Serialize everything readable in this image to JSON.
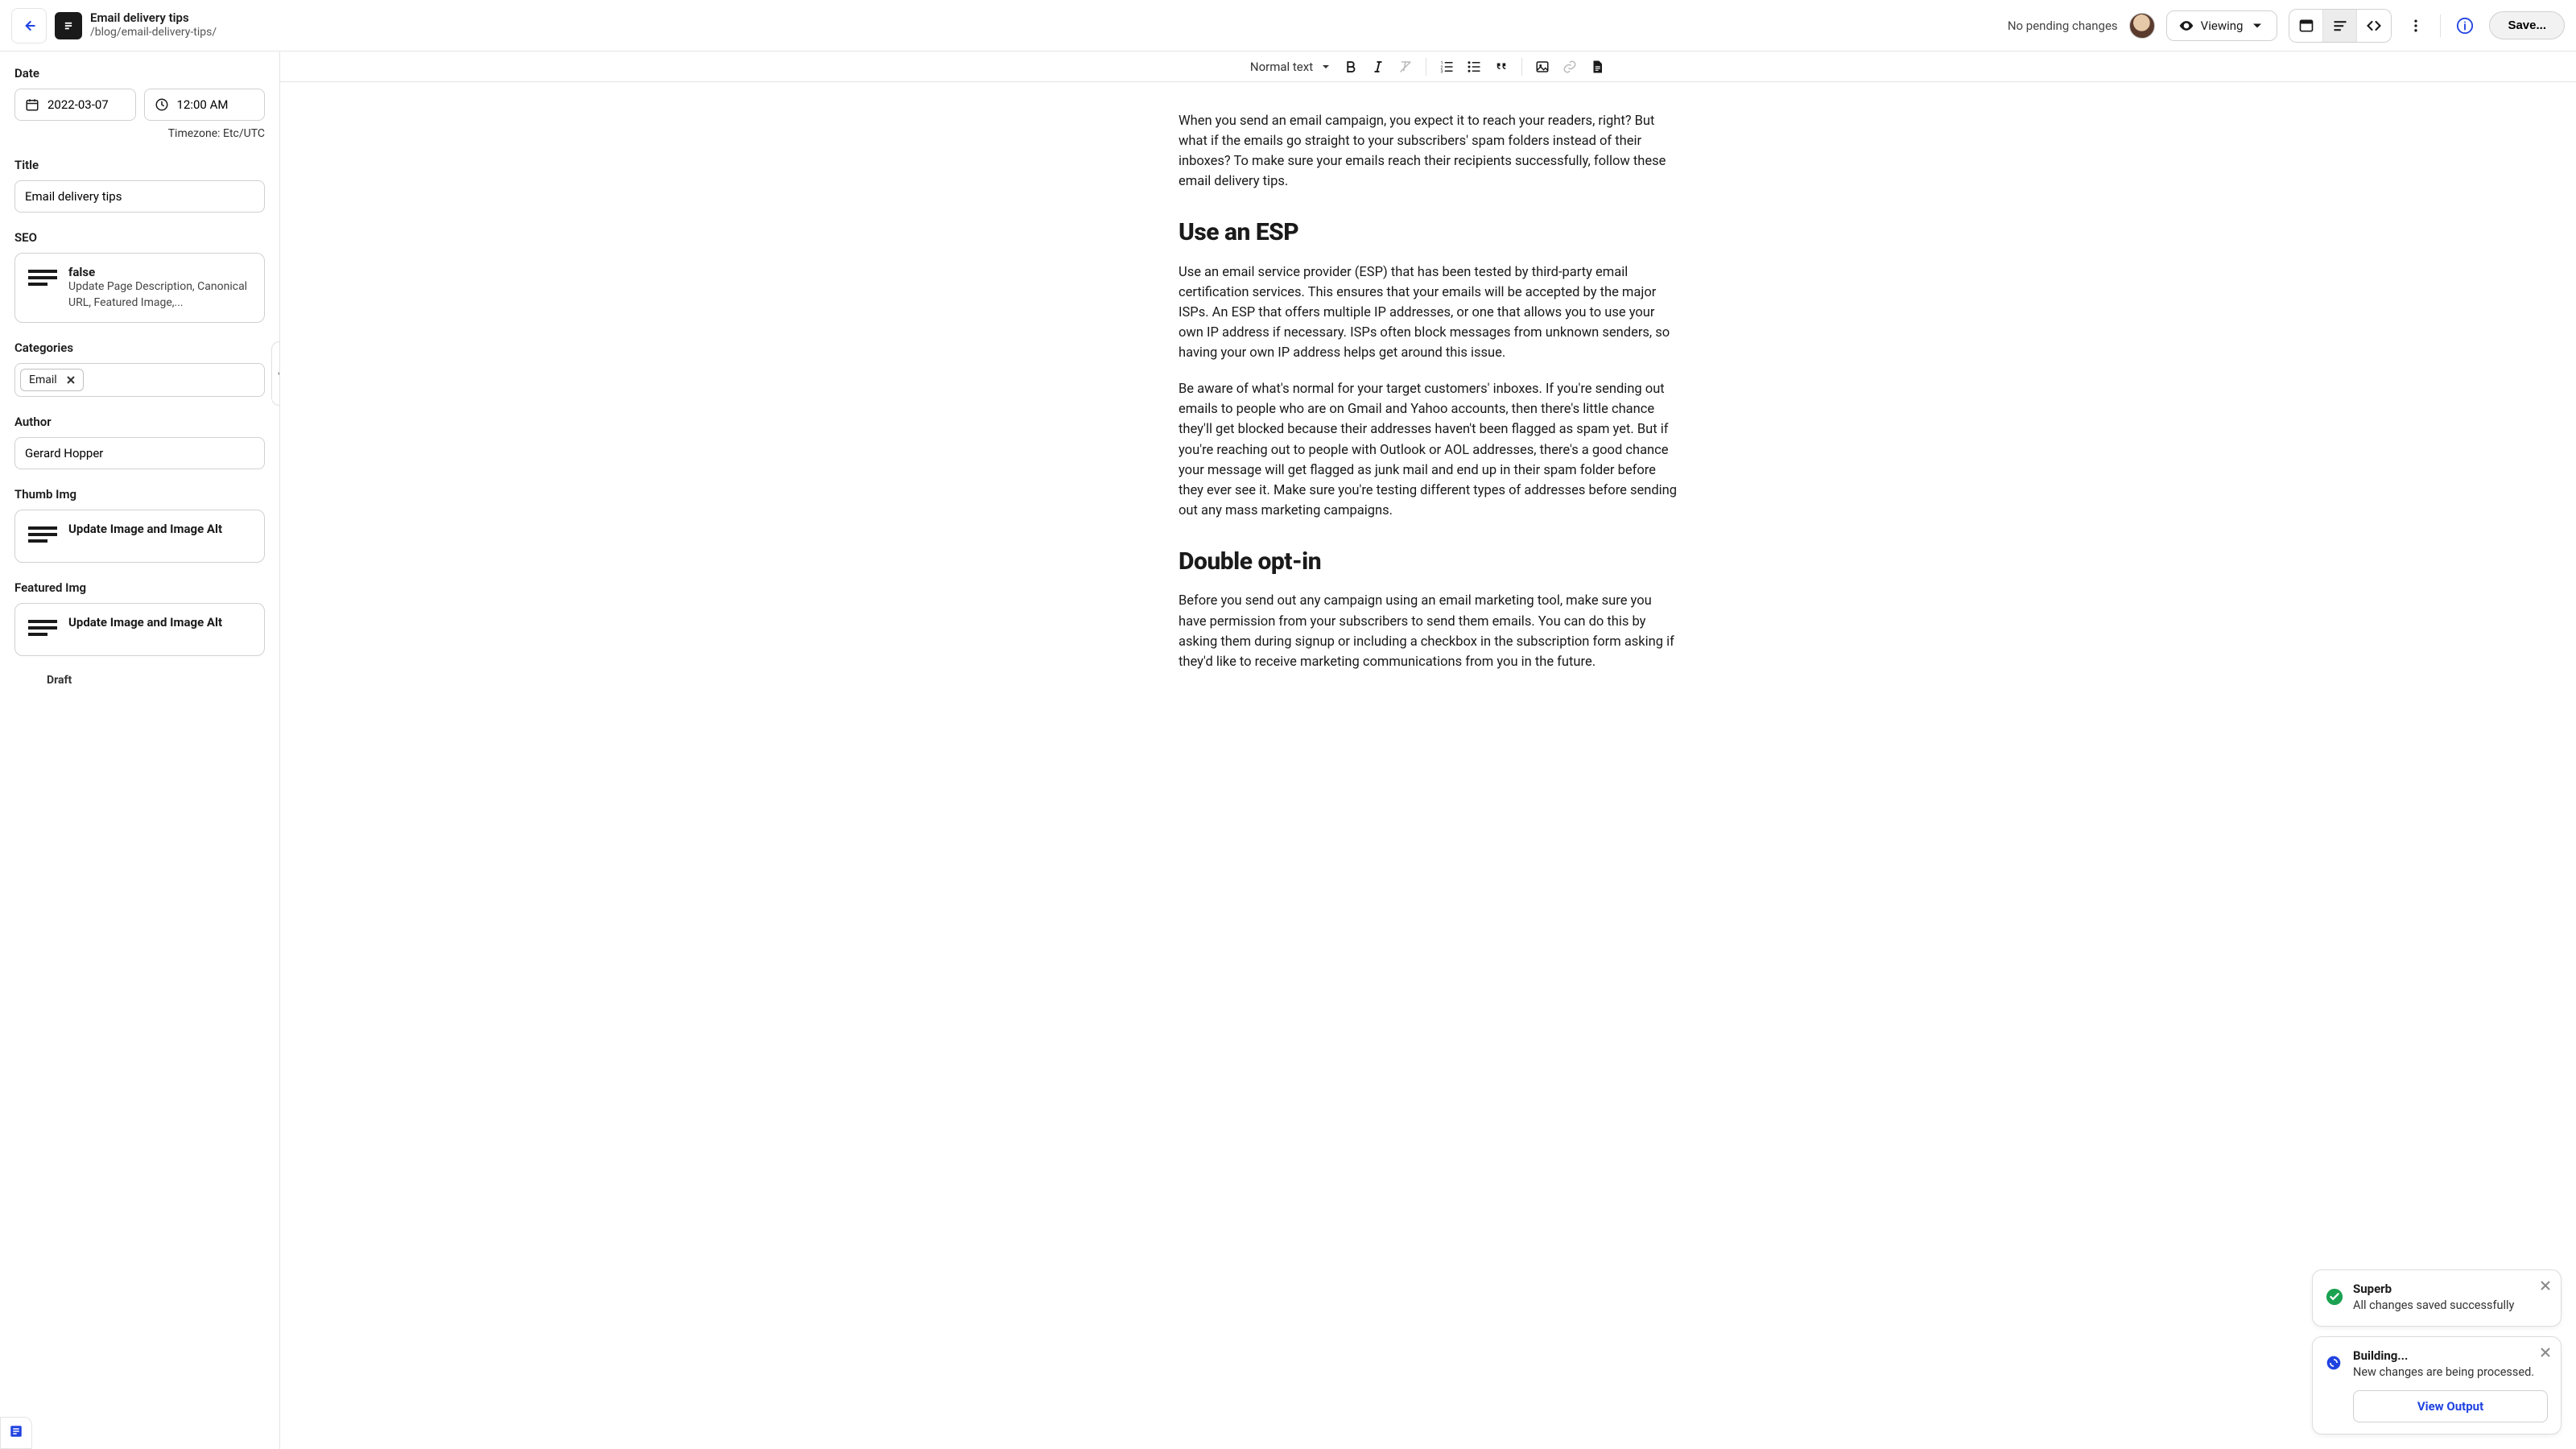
{
  "header": {
    "title": "Email delivery tips",
    "slug": "/blog/email-delivery-tips/",
    "pending_status": "No pending changes",
    "view_mode_label": "Viewing",
    "save_label": "Save..."
  },
  "sidebar": {
    "date": {
      "label": "Date",
      "value": "2022-03-07",
      "time": "12:00 AM",
      "timezone": "Timezone: Etc/UTC"
    },
    "title": {
      "label": "Title",
      "value": "Email delivery tips"
    },
    "seo": {
      "label": "SEO",
      "card_title": "false",
      "card_sub": "Update Page Description, Canonical URL, Featured Image,..."
    },
    "categories": {
      "label": "Categories",
      "tags": [
        "Email"
      ]
    },
    "author": {
      "label": "Author",
      "value": "Gerard Hopper"
    },
    "thumb": {
      "label": "Thumb Img",
      "card_title": "Update Image and Image Alt"
    },
    "featured": {
      "label": "Featured Img",
      "card_title": "Update Image and Image Alt"
    },
    "draft_peek": "Draft"
  },
  "toolbar": {
    "text_style": "Normal text"
  },
  "content": {
    "p1": "When you send an email campaign, you expect it to reach your readers, right? But what if the emails go straight to your subscribers' spam folders instead of their inboxes? To make sure your emails reach their recipients successfully, follow these email delivery tips.",
    "h1": "Use an ESP",
    "p2": "Use an email service provider (ESP) that has been tested by third-party email certification services. This ensures that your emails will be accepted by the major ISPs. An ESP that offers multiple IP addresses, or one that allows you to use your own IP address if necessary. ISPs often block messages from unknown senders, so having your own IP address helps get around this issue.",
    "p3": "Be aware of what's normal for your target customers' inboxes. If you're sending out emails to people who are on Gmail and Yahoo accounts, then there's little chance they'll get blocked because their addresses haven't been flagged as spam yet. But if you're reaching out to people with Outlook or AOL addresses, there's a good chance your message will get flagged as junk mail and end up in their spam folder before they ever see it. Make sure you're testing different types of addresses before sending out any mass marketing campaigns.",
    "h2": "Double opt-in",
    "p4": "Before you send out any campaign using an email marketing tool, make sure you have permission from your subscribers to send them emails. You can do this by asking them during signup or including a checkbox in the subscription form asking if they'd like to receive marketing communications from you in the future."
  },
  "toasts": {
    "success": {
      "title": "Superb",
      "message": "All changes saved successfully"
    },
    "building": {
      "title": "Building...",
      "message": "New changes are being processed.",
      "action": "View Output"
    }
  }
}
